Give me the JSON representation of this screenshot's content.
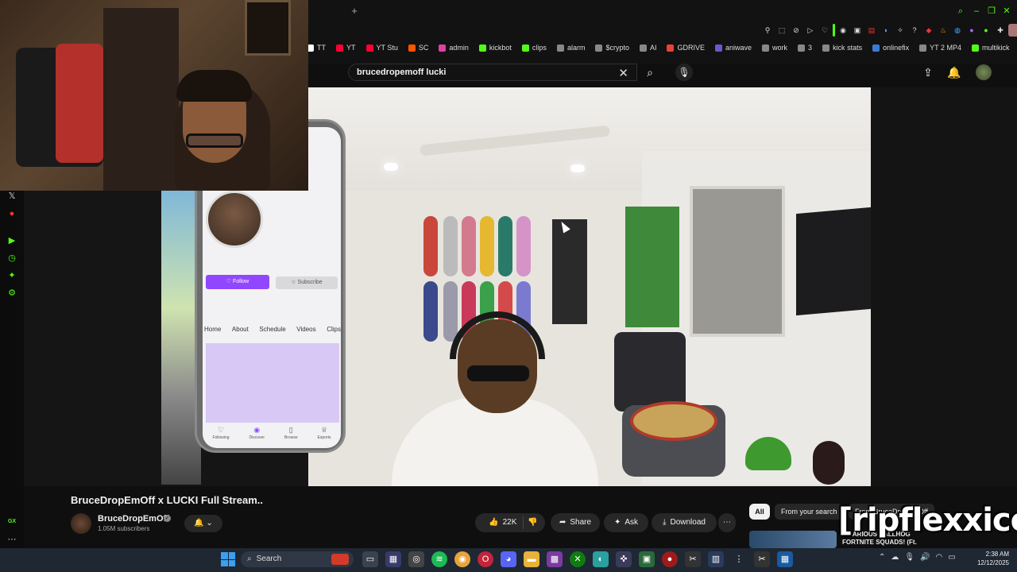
{
  "browser": {
    "new_tab_label": "+",
    "bookmarks": [
      {
        "label": "TT",
        "color": "#ffffff"
      },
      {
        "label": "YT",
        "color": "#ff0033"
      },
      {
        "label": "YT Stu",
        "color": "#ff0033"
      },
      {
        "label": "SC",
        "color": "#ff5500"
      },
      {
        "label": "admin",
        "color": "#e040a0"
      },
      {
        "label": "kickbot",
        "color": "#53fc18"
      },
      {
        "label": "clips",
        "color": "#53fc18"
      },
      {
        "label": "alarm",
        "color": "#888888"
      },
      {
        "label": "$crypto",
        "color": "#888888"
      },
      {
        "label": "AI",
        "color": "#888888"
      },
      {
        "label": "GDRIVE",
        "color": "#ea4335"
      },
      {
        "label": "aniwave",
        "color": "#6a5acd"
      },
      {
        "label": "work",
        "color": "#888888"
      },
      {
        "label": "3",
        "color": "#888888"
      },
      {
        "label": "kick stats",
        "color": "#888888"
      },
      {
        "label": "onlinefix",
        "color": "#3a7bd5"
      },
      {
        "label": "YT 2 MP4",
        "color": "#888888"
      },
      {
        "label": "multikick",
        "color": "#53fc18"
      }
    ]
  },
  "youtube": {
    "search": {
      "query": "brucedropemoff lucki",
      "clear_icon": "close-icon"
    },
    "video": {
      "title": "BruceDropEmOff x LUCKI Full Stream..",
      "channel": "BruceDropEmOff",
      "subscribers": "1.05M subscribers",
      "likes": "22K",
      "share_label": "Share",
      "ask_label": "Ask",
      "download_label": "Download"
    },
    "chips": {
      "all": "All",
      "from_search": "From your search",
      "from_channel": "From BruceDropEmOff"
    },
    "recommendation": {
      "title_line1": "HILARIOUS BALLHOG",
      "title_line2": "FORTNITE SQUADS! (Ft."
    }
  },
  "phone": {
    "follow": "Follow",
    "subscribe": "Subscribe",
    "tabs": [
      "Home",
      "About",
      "Schedule",
      "Videos",
      "Clips"
    ],
    "nav": [
      {
        "label": "Following",
        "icon": "heart-icon"
      },
      {
        "label": "Discover",
        "icon": "compass-icon"
      },
      {
        "label": "Browse",
        "icon": "browse-icon"
      },
      {
        "label": "Esports",
        "icon": "trophy-icon"
      }
    ]
  },
  "overlay": {
    "watermark": "[ripflexxico]"
  },
  "taskbar": {
    "search_label": "Search",
    "time": "2:38 AM",
    "date": "12/12/2025"
  },
  "colors": {
    "accent_purple": "#9147ff",
    "yt_red": "#ff0033",
    "kick_green": "#53fc18"
  }
}
